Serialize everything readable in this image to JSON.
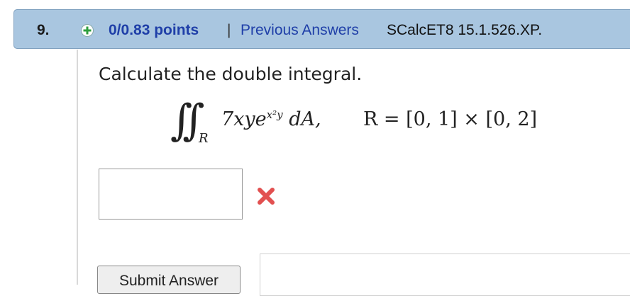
{
  "question": {
    "number": "9.",
    "points": "0/0.83 points",
    "separator": "|",
    "previous_answers_label": "Previous Answers",
    "source": "SCalcET8 15.1.526.XP."
  },
  "prompt": "Calculate the double integral.",
  "math": {
    "integral_sign": "∫∫",
    "region_symbol": "R",
    "integrand": "7xye",
    "exponent": "x²y",
    "differential": "dA,",
    "region_definition": "R = [0, 1] × [0, 2]"
  },
  "answer": {
    "value": "",
    "status": "incorrect",
    "status_color": "#e25050"
  },
  "submit_label": "Submit Answer",
  "colors": {
    "header_bg": "#a9c6e0",
    "link": "#1f3fa8",
    "status_icon": "#2e9e3e"
  }
}
